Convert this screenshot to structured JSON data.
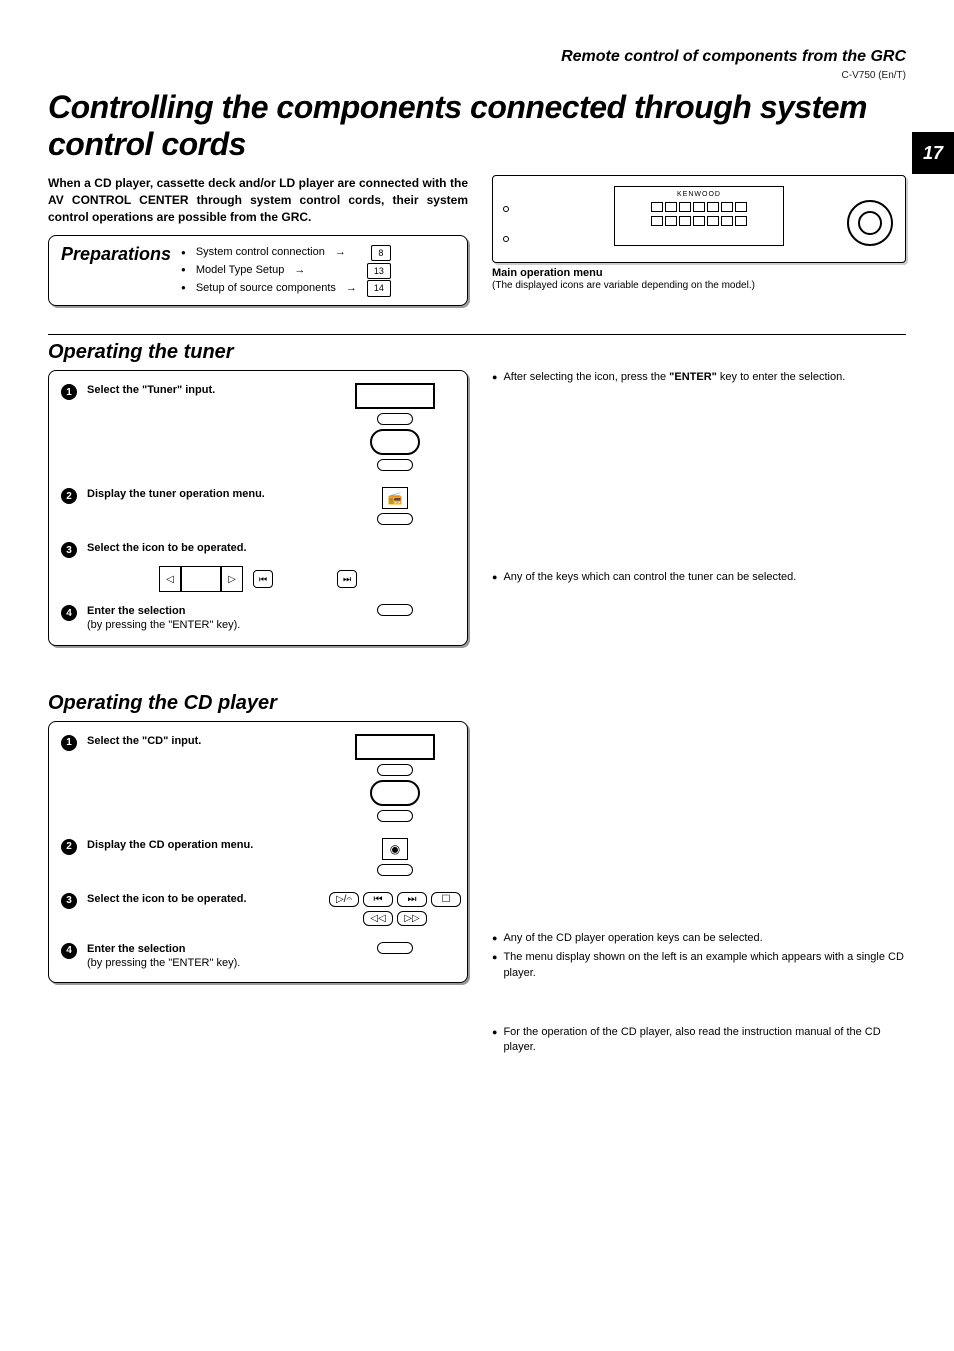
{
  "header": {
    "section": "Remote control of components from the GRC",
    "code": "C-V750 (En/T)",
    "page": "17"
  },
  "title": "Controlling the components connected through system control cords",
  "intro": "When a CD player, cassette deck and/or LD player are connected with the AV CONTROL CENTER through system control cords, their system control operations are possible from the GRC.",
  "prep": {
    "title": "Preparations",
    "items": [
      {
        "label": "System control connection",
        "page": "8"
      },
      {
        "label": "Model Type Setup",
        "page": "13"
      },
      {
        "label": "Setup of source components",
        "page": "14"
      }
    ]
  },
  "device": {
    "brand": "KENWOOD",
    "caption": "Main operation menu",
    "note": "(The displayed icons are variable depending on the model.)"
  },
  "tuner": {
    "title": "Operating the tuner",
    "steps": [
      {
        "n": "1",
        "text": "Select the \"Tuner\" input."
      },
      {
        "n": "2",
        "text": "Display the tuner operation menu."
      },
      {
        "n": "3",
        "text": "Select the icon to be operated."
      },
      {
        "n": "4",
        "text": "Enter the selection",
        "sub": "(by pressing the \"ENTER\" key)."
      }
    ],
    "notes": [
      {
        "pre": "After selecting the icon, press the ",
        "bold": "\"ENTER\"",
        "post": " key to enter the selection."
      },
      {
        "text": "Any of the keys which can control the tuner can be selected."
      }
    ]
  },
  "cd": {
    "title": "Operating the CD player",
    "steps": [
      {
        "n": "1",
        "text": "Select the \"CD\" input."
      },
      {
        "n": "2",
        "text": "Display the CD operation menu."
      },
      {
        "n": "3",
        "text": "Select the icon to be operated."
      },
      {
        "n": "4",
        "text": "Enter the selection",
        "sub": "(by pressing the \"ENTER\" key)."
      }
    ],
    "notes": [
      {
        "text": "Any of the CD player operation keys can be selected."
      },
      {
        "text": "The menu display shown on the left is an example which appears with a single CD player."
      },
      {
        "text": "For the operation of the CD player, also read the instruction manual of the CD player."
      }
    ]
  }
}
